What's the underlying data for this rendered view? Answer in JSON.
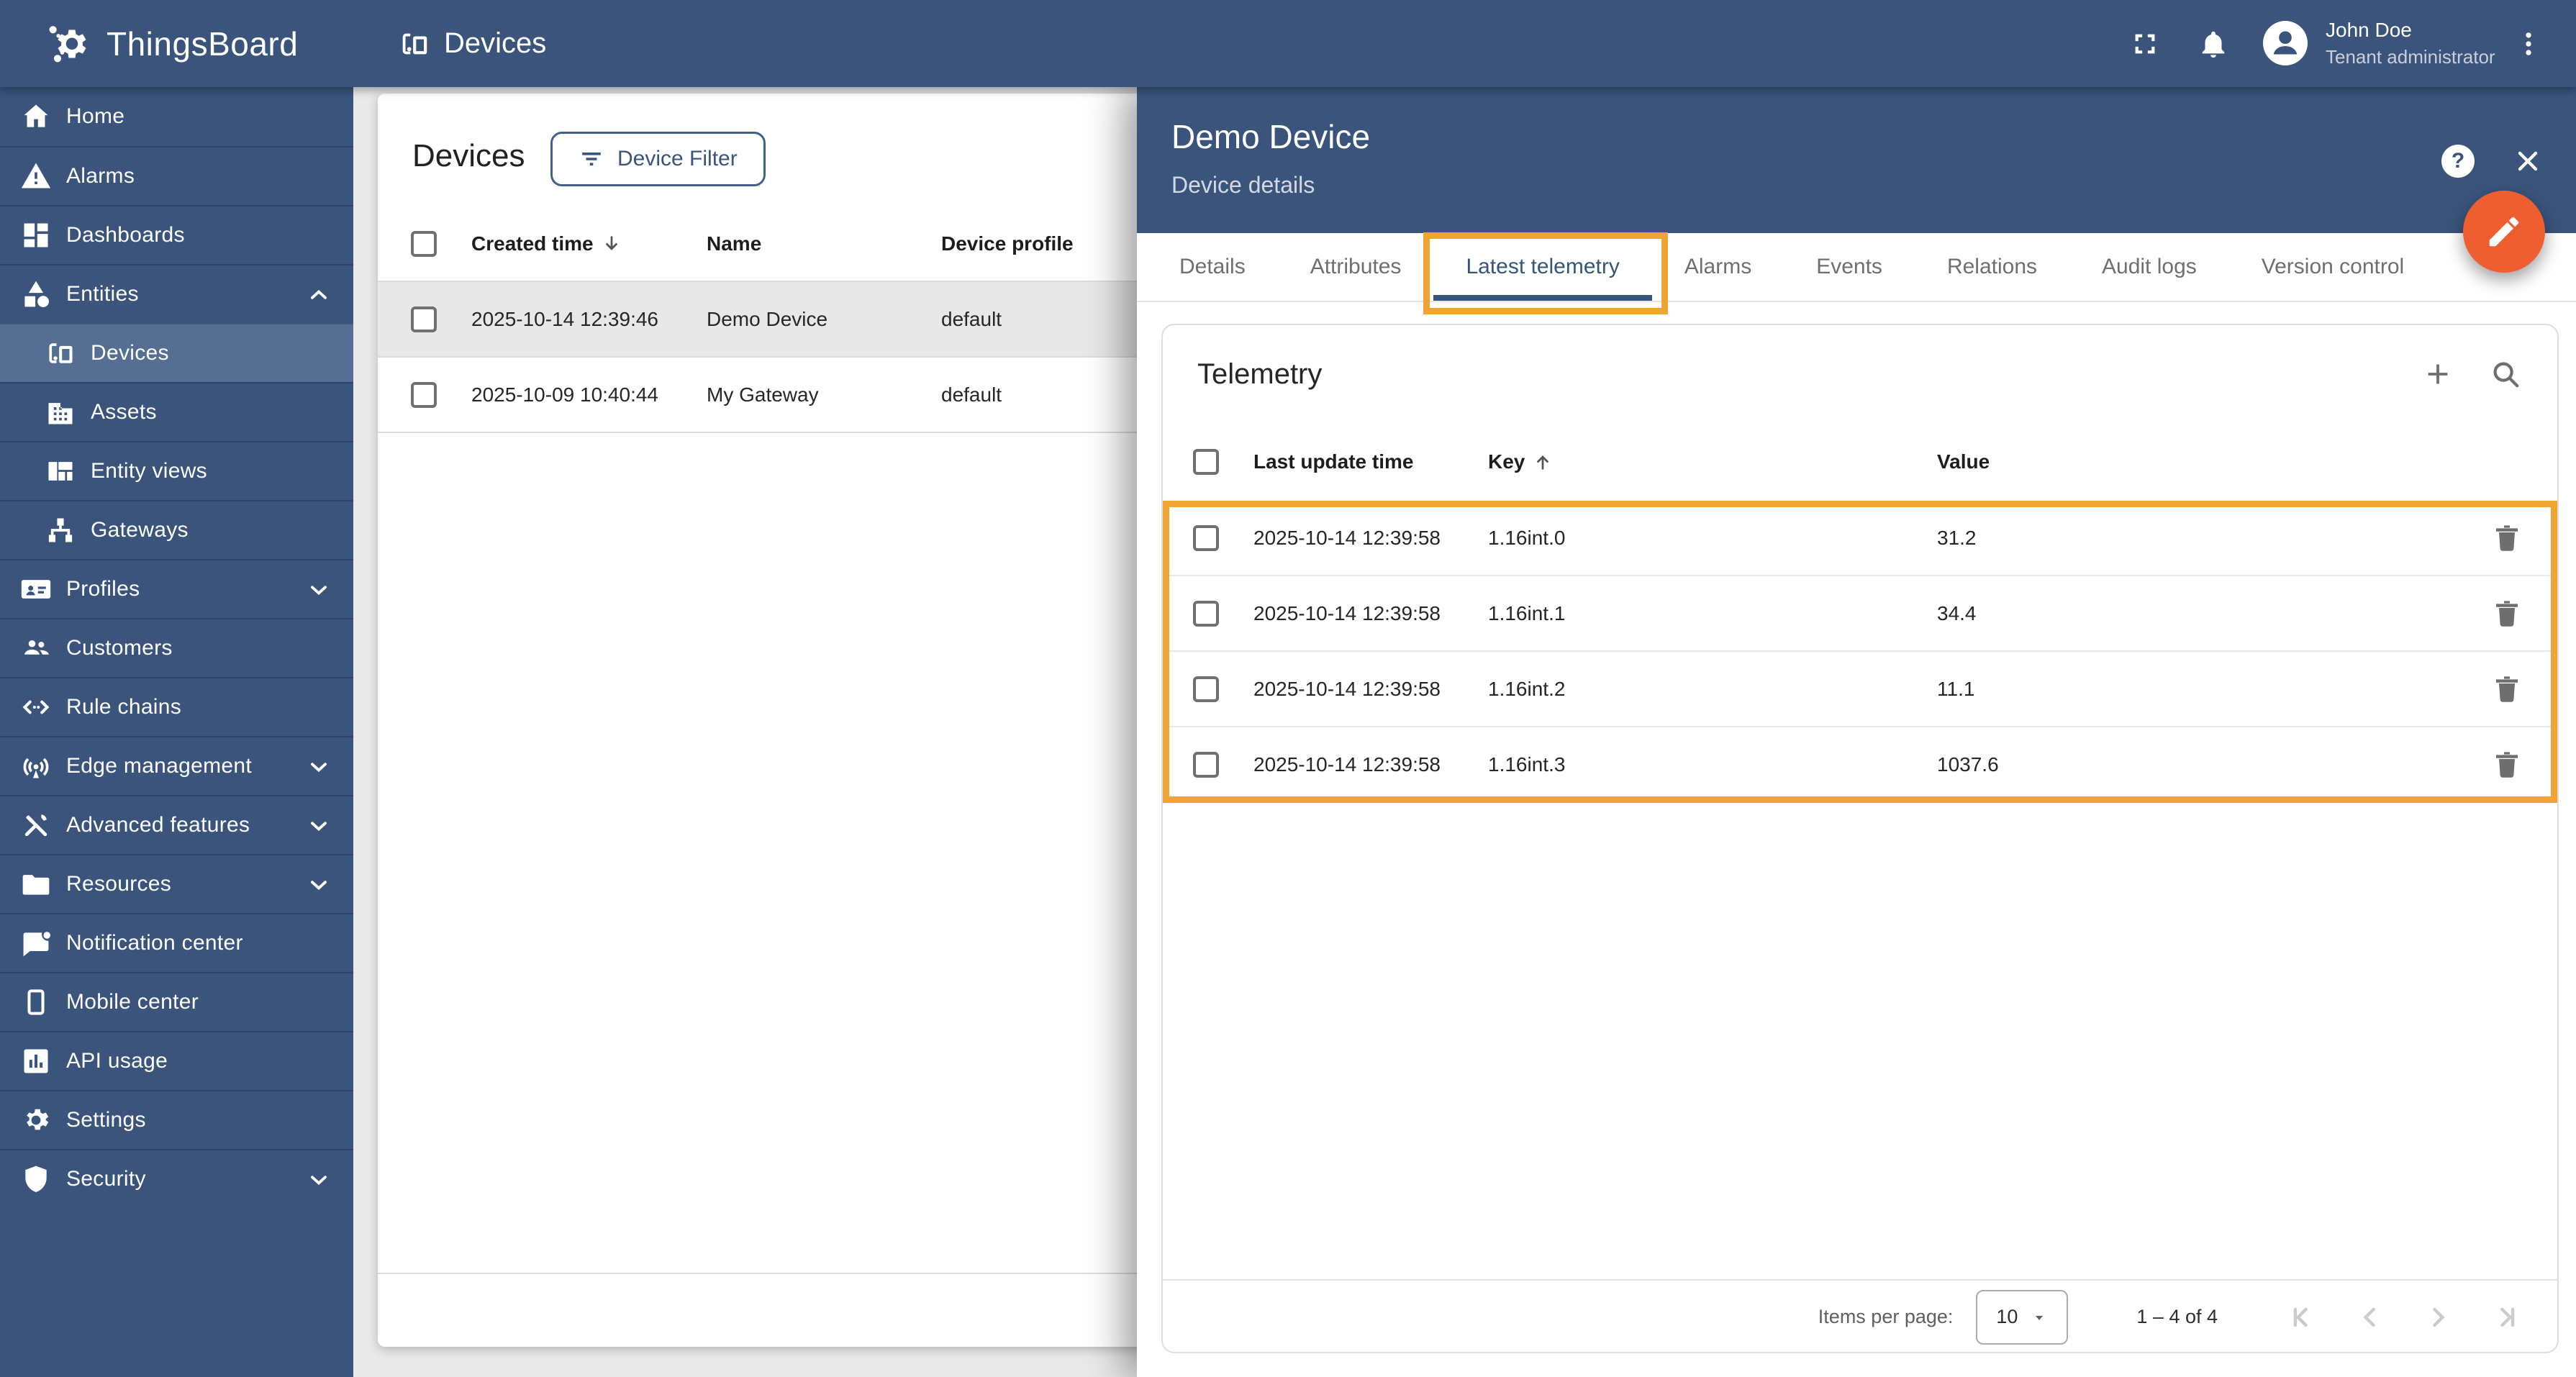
{
  "colors": {
    "primary_blue": "#3a547c",
    "sidebar_active": "#556e91",
    "annotation_orange": "#f0a432",
    "fab_orange": "#ee5e30",
    "active_tab_blue": "#36557c"
  },
  "icons": {
    "help_glyph": "?"
  },
  "topbar": {
    "logo_text": "ThingsBoard",
    "breadcrumb": "Devices",
    "user_name": "John Doe",
    "user_role": "Tenant administrator"
  },
  "sidebar": {
    "items": [
      {
        "label": "Home"
      },
      {
        "label": "Alarms"
      },
      {
        "label": "Dashboards"
      },
      {
        "label": "Entities",
        "chevron": "up"
      },
      {
        "label": "Devices",
        "sub": true,
        "active": true
      },
      {
        "label": "Assets",
        "sub": true
      },
      {
        "label": "Entity views",
        "sub": true
      },
      {
        "label": "Gateways",
        "sub": true
      },
      {
        "label": "Profiles",
        "chevron": "down"
      },
      {
        "label": "Customers"
      },
      {
        "label": "Rule chains"
      },
      {
        "label": "Edge management",
        "chevron": "down"
      },
      {
        "label": "Advanced features",
        "chevron": "down"
      },
      {
        "label": "Resources",
        "chevron": "down"
      },
      {
        "label": "Notification center"
      },
      {
        "label": "Mobile center"
      },
      {
        "label": "API usage"
      },
      {
        "label": "Settings"
      },
      {
        "label": "Security",
        "chevron": "down"
      }
    ]
  },
  "devices_panel": {
    "title": "Devices",
    "filter_button_label": "Device Filter",
    "columns": {
      "created": "Created time",
      "name": "Name",
      "profile": "Device profile"
    },
    "rows": [
      {
        "created": "2025-10-14 12:39:46",
        "name": "Demo Device",
        "profile": "default"
      },
      {
        "created": "2025-10-09 10:40:44",
        "name": "My Gateway",
        "profile": "default"
      }
    ]
  },
  "drawer": {
    "title": "Demo Device",
    "subtitle": "Device details",
    "tabs": [
      "Details",
      "Attributes",
      "Latest telemetry",
      "Alarms",
      "Events",
      "Relations",
      "Audit logs",
      "Version control"
    ],
    "active_tab": "Latest telemetry"
  },
  "telemetry": {
    "title": "Telemetry",
    "columns": {
      "time": "Last update time",
      "key": "Key",
      "value": "Value"
    },
    "rows": [
      {
        "time": "2025-10-14 12:39:58",
        "key": "1.16int.0",
        "value": "31.2"
      },
      {
        "time": "2025-10-14 12:39:58",
        "key": "1.16int.1",
        "value": "34.4"
      },
      {
        "time": "2025-10-14 12:39:58",
        "key": "1.16int.2",
        "value": "11.1"
      },
      {
        "time": "2025-10-14 12:39:58",
        "key": "1.16int.3",
        "value": "1037.6"
      }
    ],
    "pagination": {
      "items_per_page_label": "Items per page:",
      "items_per_page": "10",
      "range": "1 – 4 of 4"
    }
  }
}
